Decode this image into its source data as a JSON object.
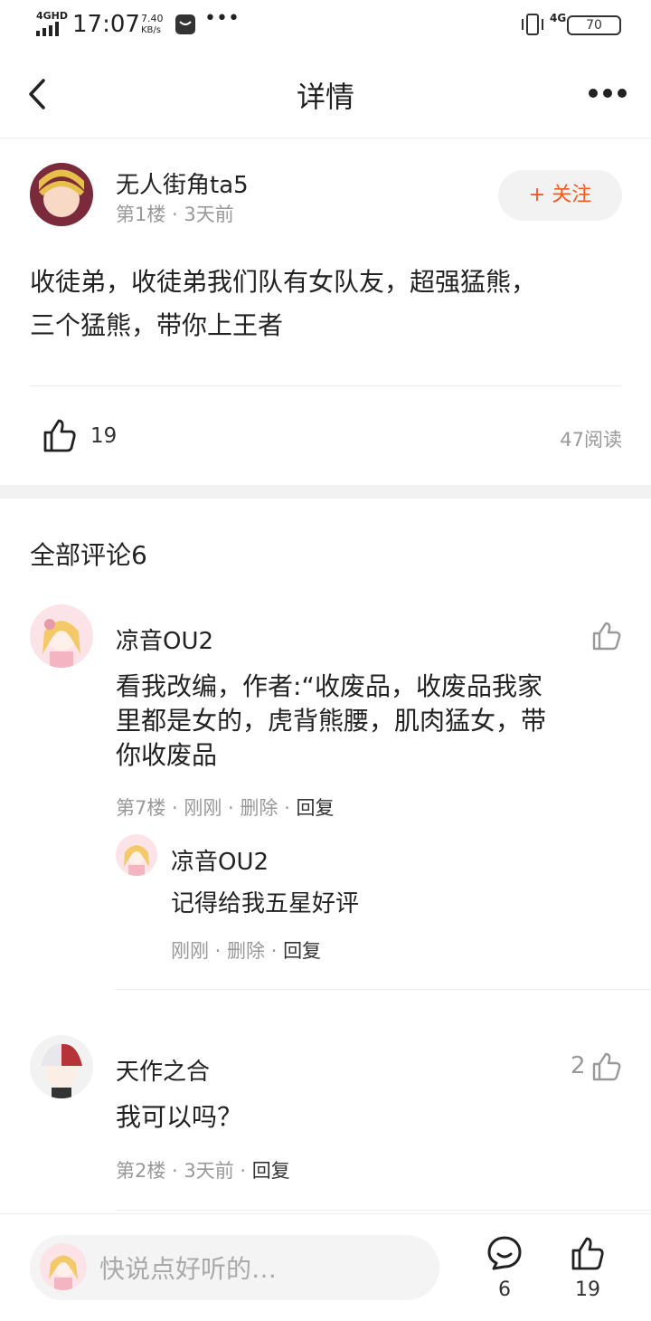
{
  "status_bar": {
    "network": "4GHD",
    "time": "17:07",
    "speed_value": "7.40",
    "speed_unit": "KB/s",
    "right_network": "4G",
    "battery": "70"
  },
  "nav": {
    "title": "详情"
  },
  "post": {
    "author": "无人街角ta5",
    "floor_time": "第1楼 · 3天前",
    "follow_label": "+ 关注",
    "content_line1": "收徒弟，收徒弟我们队有女队友，超强猛熊，",
    "content_line2": "三个猛熊，带你上王者",
    "likes": "19",
    "reads": "47阅读"
  },
  "comments_header": "全部评论6",
  "comments": [
    {
      "author": "凉音OU2",
      "content_line1": "看我改编，作者:“收废品，收废品我家",
      "content_line2": "里都是女的，虎背熊腰，肌肉猛女，带",
      "content_line3": "你收废品",
      "meta_floor": "第7楼 · 刚刚 · 删除 · ",
      "meta_reply": "回复",
      "reply": {
        "author": "凉音OU2",
        "content": "记得给我五星好评",
        "meta": "刚刚 · 删除 · ",
        "meta_reply": "回复"
      }
    },
    {
      "author": "天作之合",
      "likes": "2",
      "content": "我可以吗？",
      "meta_floor": "第2楼 · 3天前 · ",
      "meta_reply": "回复"
    }
  ],
  "bottom_bar": {
    "input_placeholder": "快说点好听的…",
    "comment_count": "6",
    "like_count": "19"
  },
  "colors": {
    "accent": "#f25a22",
    "muted": "#999999",
    "divider": "#ececec"
  }
}
